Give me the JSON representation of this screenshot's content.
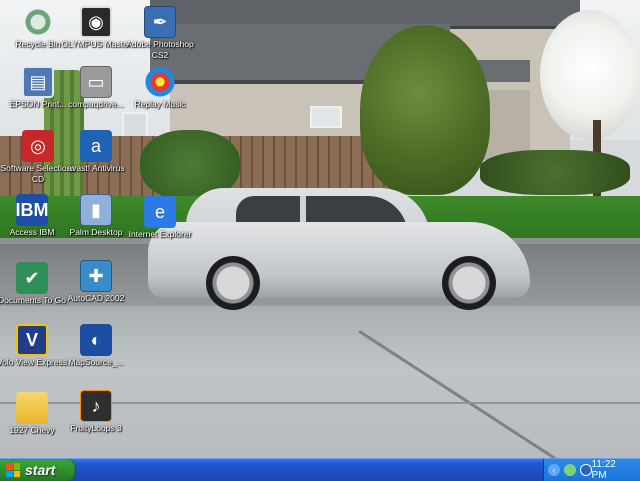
{
  "desktop": {
    "icons": [
      {
        "id": "recycle-bin",
        "label": "Recycle Bin"
      },
      {
        "id": "olympus",
        "label": "OLYMPUS Master"
      },
      {
        "id": "photoshop",
        "label": "Adobe Photoshop CS2"
      },
      {
        "id": "epson",
        "label": "EPSON Print..."
      },
      {
        "id": "compaq",
        "label": "compaqdrive..."
      },
      {
        "id": "replay",
        "label": "Replay Music"
      },
      {
        "id": "software",
        "label": "Software Selections CD"
      },
      {
        "id": "avast",
        "label": "avast! Antivirus"
      },
      {
        "id": "ibm",
        "label": "Access IBM"
      },
      {
        "id": "palm",
        "label": "Palm Desktop"
      },
      {
        "id": "ie",
        "label": "Internet Explorer"
      },
      {
        "id": "docs",
        "label": "Documents To Go"
      },
      {
        "id": "autocad",
        "label": "AutoCAD 2002"
      },
      {
        "id": "volo",
        "label": "Volo View Express"
      },
      {
        "id": "mapsource",
        "label": "MapSource_..."
      },
      {
        "id": "folder",
        "label": "1927 Chevy"
      },
      {
        "id": "fruity",
        "label": "FruityLoops 3"
      }
    ]
  },
  "taskbar": {
    "start_label": "start",
    "clock": "11:22 PM",
    "tray_icons": [
      "show-hidden-arrow-icon",
      "network-icon",
      "antivirus-icon"
    ]
  },
  "colors": {
    "taskbar_blue": "#1f4ec2",
    "start_green": "#3ea53a",
    "tray_blue": "#1b72d6"
  }
}
